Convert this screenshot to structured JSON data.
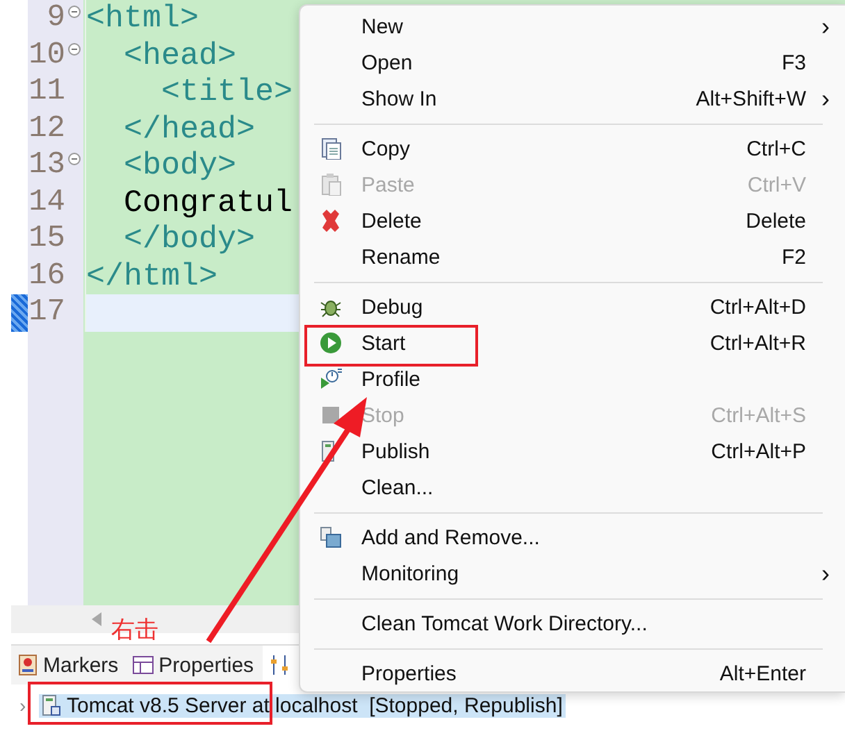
{
  "editor": {
    "lines": [
      {
        "number": "9",
        "foldable": true,
        "current": false,
        "segments": [
          {
            "kind": "tag",
            "text": "<html>"
          }
        ]
      },
      {
        "number": "10",
        "foldable": true,
        "current": false,
        "segments": [
          {
            "kind": "tag",
            "text": "  <head>"
          }
        ]
      },
      {
        "number": "11",
        "foldable": false,
        "current": false,
        "segments": [
          {
            "kind": "tag",
            "text": "    <title>"
          }
        ]
      },
      {
        "number": "12",
        "foldable": false,
        "current": false,
        "segments": [
          {
            "kind": "tag",
            "text": "  </head>"
          }
        ]
      },
      {
        "number": "13",
        "foldable": true,
        "current": false,
        "segments": [
          {
            "kind": "tag",
            "text": "  <body>"
          }
        ]
      },
      {
        "number": "14",
        "foldable": false,
        "current": false,
        "segments": [
          {
            "kind": "plain",
            "text": "  Congratul"
          }
        ]
      },
      {
        "number": "15",
        "foldable": false,
        "current": false,
        "segments": [
          {
            "kind": "tag",
            "text": "  </body>"
          }
        ]
      },
      {
        "number": "16",
        "foldable": false,
        "current": false,
        "segments": [
          {
            "kind": "tag",
            "text": "</html>"
          }
        ]
      },
      {
        "number": "17",
        "foldable": false,
        "current": true
      }
    ]
  },
  "bottom_panel": {
    "tabs": [
      {
        "label": "Markers",
        "selected": false
      },
      {
        "label": "Properties",
        "selected": false
      },
      {
        "selected": true
      }
    ],
    "servers": [
      {
        "label": "Tomcat v8.5 Server at localhost  [Stopped, Republish]",
        "selected": true,
        "expanded": false
      }
    ]
  },
  "context_menu": {
    "items": [
      {
        "kind": "item",
        "label": "New",
        "submenu": true,
        "disabled": false
      },
      {
        "kind": "item",
        "label": "Open",
        "shortcut": "F3",
        "submenu": false,
        "disabled": false
      },
      {
        "kind": "item",
        "label": "Show In",
        "shortcut": "Alt+Shift+W",
        "submenu": true,
        "disabled": false
      },
      {
        "kind": "separator"
      },
      {
        "kind": "item",
        "label": "Copy",
        "shortcut": "Ctrl+C",
        "submenu": false,
        "disabled": false
      },
      {
        "kind": "item",
        "label": "Paste",
        "shortcut": "Ctrl+V",
        "submenu": false,
        "disabled": true
      },
      {
        "kind": "item",
        "label": "Delete",
        "shortcut": "Delete",
        "submenu": false,
        "disabled": false
      },
      {
        "kind": "item",
        "label": "Rename",
        "shortcut": "F2",
        "submenu": false,
        "disabled": false
      },
      {
        "kind": "separator"
      },
      {
        "kind": "item",
        "label": "Debug",
        "shortcut": "Ctrl+Alt+D",
        "submenu": false,
        "disabled": false
      },
      {
        "kind": "item",
        "label": "Start",
        "shortcut": "Ctrl+Alt+R",
        "submenu": false,
        "disabled": false
      },
      {
        "kind": "item",
        "label": "Profile",
        "submenu": false,
        "disabled": false
      },
      {
        "kind": "item",
        "label": "Stop",
        "shortcut": "Ctrl+Alt+S",
        "submenu": false,
        "disabled": true
      },
      {
        "kind": "item",
        "label": "Publish",
        "shortcut": "Ctrl+Alt+P",
        "submenu": false,
        "disabled": false
      },
      {
        "kind": "item",
        "label": "Clean...",
        "submenu": false,
        "disabled": false
      },
      {
        "kind": "separator"
      },
      {
        "kind": "item",
        "label": "Add and Remove...",
        "submenu": false,
        "disabled": false
      },
      {
        "kind": "item",
        "label": "Monitoring",
        "submenu": true,
        "disabled": false
      },
      {
        "kind": "separator"
      },
      {
        "kind": "item",
        "label": "Clean Tomcat Work Directory...",
        "submenu": false,
        "disabled": false
      },
      {
        "kind": "separator"
      },
      {
        "kind": "item",
        "label": "Properties",
        "shortcut": "Alt+Enter",
        "submenu": false,
        "disabled": false
      }
    ],
    "submenu_glyph": "›"
  },
  "annotation": {
    "note": "右击",
    "expander_glyph": "›"
  }
}
